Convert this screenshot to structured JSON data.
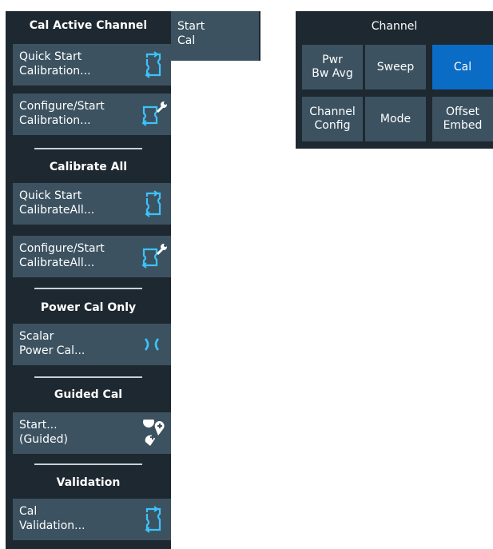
{
  "colors": {
    "panel_bg": "#1e2830",
    "button_bg": "#3c5260",
    "active_bg": "#0a6cc4",
    "text": "#ffffff",
    "divider": "#c9d0d6"
  },
  "start_cal": {
    "label": "Start\nCal"
  },
  "softkeys": {
    "sections": [
      {
        "title": "Cal Active Channel",
        "buttons": [
          {
            "label": "Quick Start\nCalibration...",
            "icon": "calibration-icon"
          },
          {
            "label": "Configure/Start\nCalibration...",
            "icon": "calibration-wrench-icon"
          }
        ]
      },
      {
        "title": "Calibrate All",
        "buttons": [
          {
            "label": "Quick Start\nCalibrateAll...",
            "icon": "calibration-icon"
          },
          {
            "label": "Configure/Start\nCalibrateAll...",
            "icon": "calibration-wrench-icon"
          }
        ]
      },
      {
        "title": "Power Cal Only",
        "buttons": [
          {
            "label": "Scalar\nPower Cal...",
            "icon": "power-cal-icon"
          }
        ]
      },
      {
        "title": "Guided Cal",
        "buttons": [
          {
            "label": "Start...\n(Guided)",
            "icon": "guided-pins-icon"
          }
        ]
      },
      {
        "title": "Validation",
        "buttons": [
          {
            "label": "Cal\nValidation...",
            "icon": "calibration-icon"
          }
        ]
      }
    ]
  },
  "channel": {
    "title": "Channel",
    "buttons": [
      {
        "label": "Pwr\nBw Avg",
        "active": false
      },
      {
        "label": "Sweep",
        "active": false
      },
      {
        "label": "Cal",
        "active": true
      },
      {
        "label": "Channel\nConfig",
        "active": false
      },
      {
        "label": "Mode",
        "active": false
      },
      {
        "label": "Offset\nEmbed",
        "active": false
      }
    ]
  }
}
